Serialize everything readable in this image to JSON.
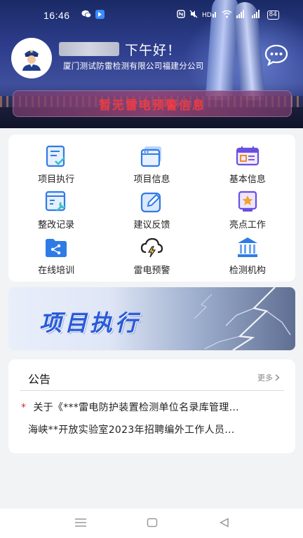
{
  "status": {
    "time": "16:46",
    "battery": "84"
  },
  "header": {
    "greeting": "下午好！",
    "company": "厦门测试防雷检测有限公司福建分公司",
    "warning": "暂无雷电预警信息"
  },
  "grid": [
    {
      "label": "项目执行",
      "icon": "task-check-icon"
    },
    {
      "label": "项目信息",
      "icon": "window-stack-icon"
    },
    {
      "label": "基本信息",
      "icon": "calendar-card-icon"
    },
    {
      "label": "整改记录",
      "icon": "wrench-doc-icon"
    },
    {
      "label": "建议反馈",
      "icon": "edit-square-icon"
    },
    {
      "label": "亮点工作",
      "icon": "star-badge-icon"
    },
    {
      "label": "在线培训",
      "icon": "folder-share-icon"
    },
    {
      "label": "雷电预警",
      "icon": "thunder-cloud-icon"
    },
    {
      "label": "检测机构",
      "icon": "institution-icon"
    }
  ],
  "banner": {
    "title": "项目执行"
  },
  "notice": {
    "title": "公告",
    "more": "更多",
    "items": [
      "关于《***雷电防护装置检测单位名录库管理...",
      "海峡**开放实验室2023年招聘编外工作人员..."
    ]
  },
  "colors": {
    "accent": "#2a5bd7",
    "warning_red": "#ff3b3b",
    "header_dark": "#1a2a66"
  }
}
